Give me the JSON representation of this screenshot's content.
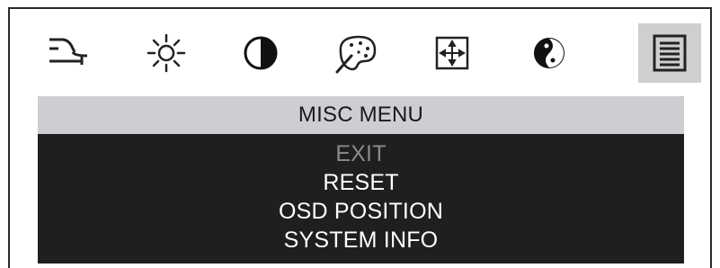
{
  "icons": [
    {
      "name": "input-select-icon",
      "selected": false
    },
    {
      "name": "brightness-icon",
      "selected": false
    },
    {
      "name": "contrast-icon",
      "selected": false
    },
    {
      "name": "color-palette-icon",
      "selected": false
    },
    {
      "name": "position-icon",
      "selected": false
    },
    {
      "name": "color-temperature-icon",
      "selected": false
    },
    {
      "name": "misc-menu-icon",
      "selected": true
    }
  ],
  "menu": {
    "title": "MISC MENU",
    "items": [
      {
        "label": "EXIT",
        "state": "dimmed"
      },
      {
        "label": "RESET",
        "state": "normal"
      },
      {
        "label": "OSD POSITION",
        "state": "normal"
      },
      {
        "label": "SYSTEM INFO",
        "state": "normal"
      }
    ]
  }
}
